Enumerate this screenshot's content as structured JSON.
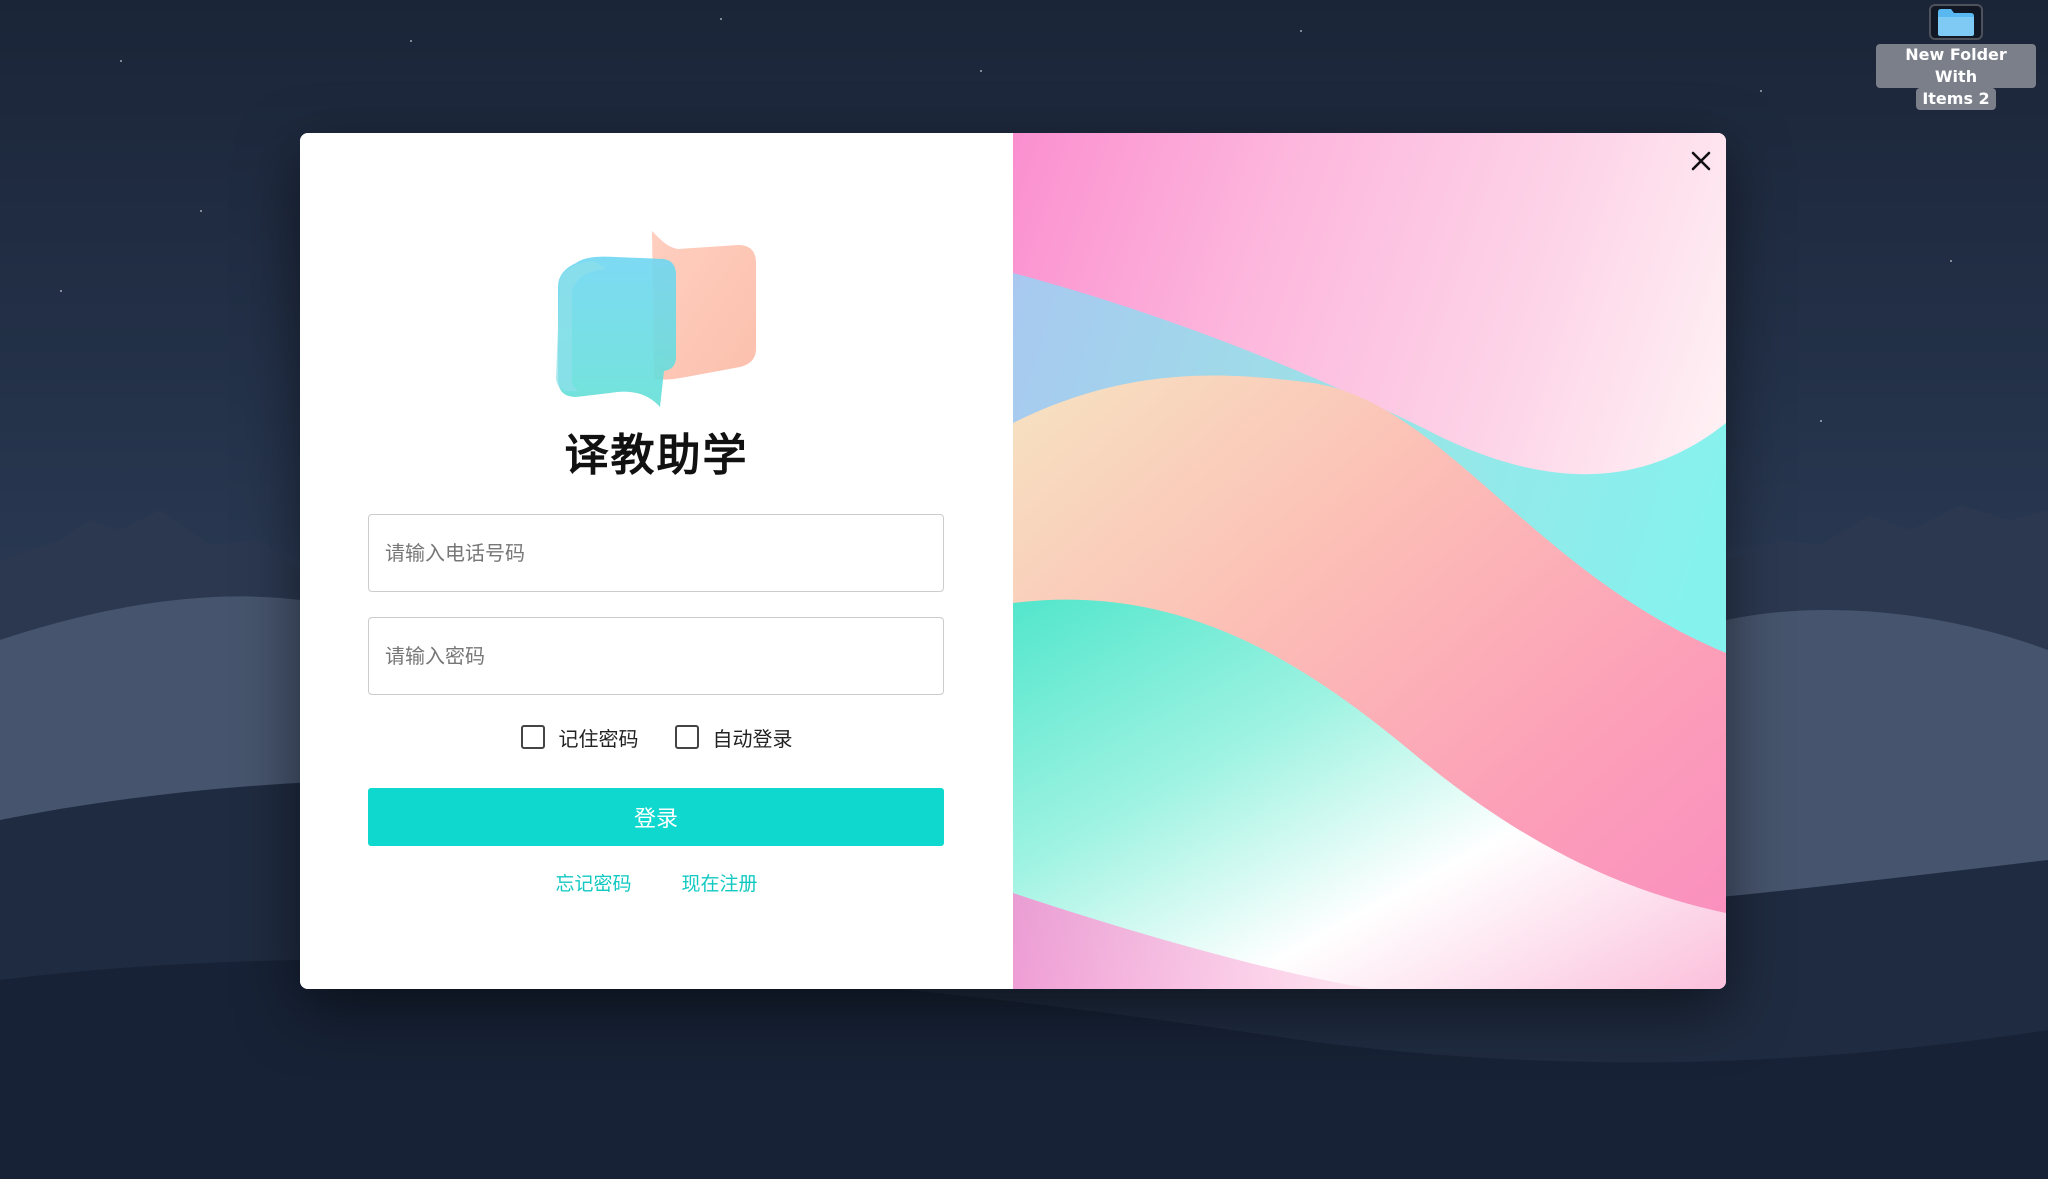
{
  "desktop": {
    "folder": {
      "label_line1": "New Folder With",
      "label_line2": "Items 2",
      "icon": "folder-icon"
    }
  },
  "login": {
    "app_name": "译教助学",
    "logo_icon": "speech-bubbles-logo",
    "phone_placeholder": "请输入电话号码",
    "password_placeholder": "请输入密码",
    "phone_value": "",
    "password_value": "",
    "remember_password_label": "记住密码",
    "auto_login_label": "自动登录",
    "remember_password_checked": false,
    "auto_login_checked": false,
    "login_button_label": "登录",
    "forgot_password_link": "忘记密码",
    "register_link": "现在注册",
    "close_icon": "close-icon",
    "accent_color": "#0fd9cf"
  }
}
